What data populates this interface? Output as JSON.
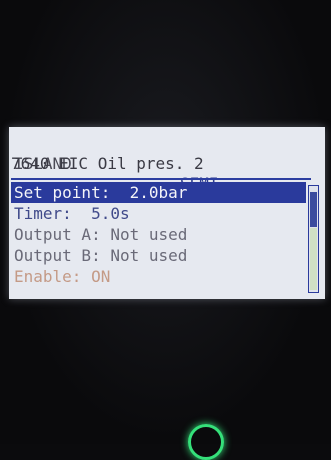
{
  "header": {
    "mode_left": "ISLAND",
    "mode_right": "SEMI",
    "title": "7640 EIC Oil pres. 2"
  },
  "menu": {
    "items": [
      {
        "label": "Set point:  2.0bar"
      },
      {
        "label": "Timer:  5.0s"
      },
      {
        "label": "Output A: Not used"
      },
      {
        "label": "Output B: Not used"
      },
      {
        "label": "Enable: ON"
      }
    ],
    "selected_index": 0
  },
  "colors": {
    "screen_bg": "#e6e9f0",
    "highlight": "#2a3a9c",
    "text_blue": "#404a8a",
    "indicator_ring": "#35e07a"
  },
  "icons": {
    "indicator": "green-ring-indicator"
  }
}
